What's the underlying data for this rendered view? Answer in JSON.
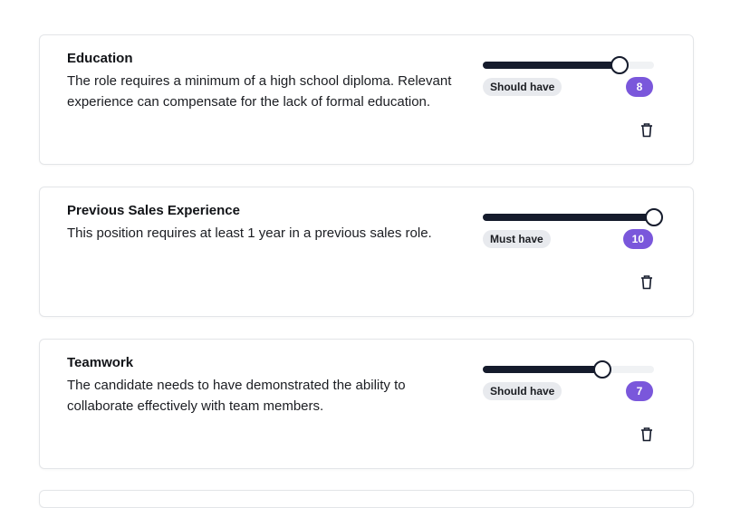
{
  "faded_header": "",
  "requirements": [
    {
      "title": "Education",
      "description": "The role requires a minimum of a high school diploma. Relevant experience can compensate for the lack of formal education.",
      "priority": "Should have",
      "score": "8",
      "slider_value": 8,
      "slider_max": 10
    },
    {
      "title": "Previous Sales Experience",
      "description": "This position requires at least 1 year in a previous sales role.",
      "priority": "Must have",
      "score": "10",
      "slider_value": 10,
      "slider_max": 10
    },
    {
      "title": "Teamwork",
      "description": "The candidate needs to have demonstrated the ability to collaborate effectively with team members.",
      "priority": "Should have",
      "score": "7",
      "slider_value": 7,
      "slider_max": 10
    }
  ],
  "icons": {
    "delete": "trash-icon"
  },
  "colors": {
    "accent": "#7a57db",
    "slider_fill": "#151b2c",
    "slider_track": "#f0f2f4",
    "tag_bg": "#e8eaee"
  }
}
